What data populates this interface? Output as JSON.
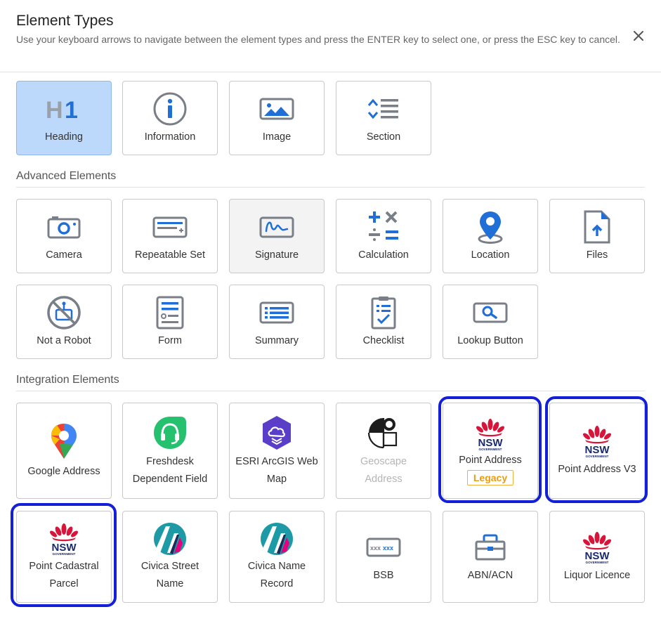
{
  "dialog": {
    "title": "Element Types",
    "description": "Use your keyboard arrows to navigate between the element types and press the ENTER key to select one, or press the ESC key to cancel."
  },
  "sections": {
    "basic": {
      "items": [
        {
          "label": "Heading",
          "icon": "heading-h1-icon",
          "state": "selected"
        },
        {
          "label": "Information",
          "icon": "info-icon"
        },
        {
          "label": "Image",
          "icon": "image-icon"
        },
        {
          "label": "Section",
          "icon": "section-icon"
        }
      ]
    },
    "advanced": {
      "title": "Advanced Elements",
      "items": [
        {
          "label": "Camera",
          "icon": "camera-icon"
        },
        {
          "label": "Repeatable Set",
          "icon": "repeatable-set-icon"
        },
        {
          "label": "Signature",
          "icon": "signature-icon",
          "state": "hover"
        },
        {
          "label": "Calculation",
          "icon": "calculation-icon"
        },
        {
          "label": "Location",
          "icon": "location-pin-icon"
        },
        {
          "label": "Files",
          "icon": "file-upload-icon"
        },
        {
          "label": "Not a Robot",
          "icon": "not-a-robot-icon"
        },
        {
          "label": "Form",
          "icon": "form-icon"
        },
        {
          "label": "Summary",
          "icon": "summary-icon"
        },
        {
          "label": "Checklist",
          "icon": "checklist-icon"
        },
        {
          "label": "Lookup Button",
          "icon": "lookup-button-icon"
        }
      ]
    },
    "integration": {
      "title": "Integration Elements",
      "items": [
        {
          "label": "Google Address",
          "icon": "google-maps-icon"
        },
        {
          "label": "Freshdesk Dependent Field",
          "icon": "freshdesk-icon"
        },
        {
          "label": "ESRI ArcGIS Web Map",
          "icon": "esri-arcgis-icon"
        },
        {
          "label": "Geoscape Address",
          "icon": "geoscape-icon",
          "state": "disabled"
        },
        {
          "label": "Point Address",
          "icon": "nsw-government-logo",
          "badge": "Legacy",
          "highlighted": true
        },
        {
          "label": "Point Address V3",
          "icon": "nsw-government-logo",
          "highlighted": true
        },
        {
          "label": "Point Cadastral Parcel",
          "icon": "nsw-government-logo",
          "highlighted": true
        },
        {
          "label": "Civica Street Name",
          "icon": "civica-icon"
        },
        {
          "label": "Civica Name Record",
          "icon": "civica-icon"
        },
        {
          "label": "BSB",
          "icon": "bsb-icon"
        },
        {
          "label": "ABN/ACN",
          "icon": "briefcase-icon"
        },
        {
          "label": "Liquor Licence",
          "icon": "nsw-government-logo"
        }
      ]
    }
  },
  "logo": {
    "nsw": "NSW",
    "government": "GOVERNMENT"
  },
  "icons_text": {
    "heading": "H1",
    "bsb": "xxx"
  },
  "colors": {
    "accent_blue": "#1f6fd6",
    "icon_gray": "#7a7f87",
    "selected_bg": "#bcd9fb",
    "highlight_border": "#1320d8",
    "legacy_orange": "#ea9c10",
    "nsw_red": "#d7153a",
    "nsw_navy": "#1a2a6e"
  }
}
